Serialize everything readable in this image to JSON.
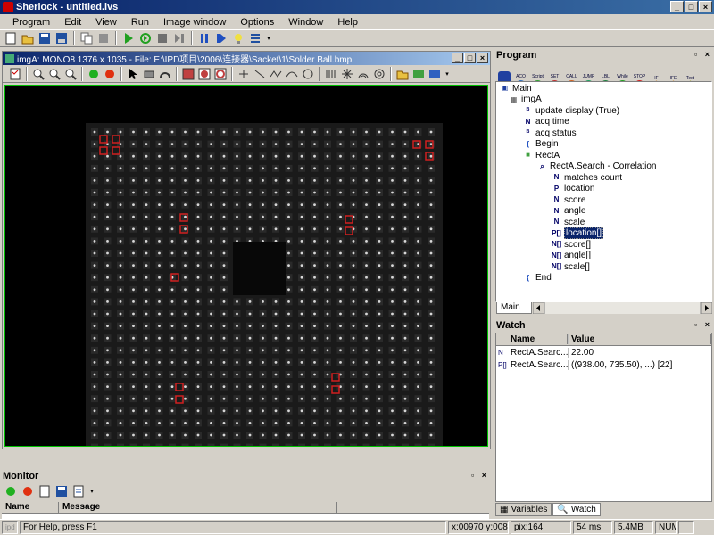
{
  "app": {
    "title": "Sherlock - untitled.ivs"
  },
  "menu": [
    "Program",
    "Edit",
    "View",
    "Run",
    "Image window",
    "Options",
    "Window",
    "Help"
  ],
  "image_window": {
    "title": "imgA: MONO8 1376 x 1035 - File: E:\\IPD项目\\2006\\连接器\\Sacket\\1\\Solder Ball.bmp"
  },
  "program": {
    "title": "Program",
    "toolbar_labels": [
      "ACQ",
      "Script",
      "SET",
      "CALL",
      "JUMP",
      "LBL",
      "While",
      "STOP",
      "IF",
      "IFE",
      "Text"
    ],
    "tree": [
      {
        "label": "Main",
        "icon": "main-icon",
        "level": 0
      },
      {
        "label": "imgA",
        "icon": "image-icon",
        "level": 1
      },
      {
        "label": "update display (True)",
        "icon": "io-icon",
        "level": 2
      },
      {
        "label": "acq time",
        "icon": "N",
        "level": 2
      },
      {
        "label": "acq status",
        "icon": "io-icon",
        "level": 2
      },
      {
        "label": "Begin",
        "icon": "brace-icon",
        "level": 2
      },
      {
        "label": "RectA",
        "icon": "rect-icon",
        "level": 2
      },
      {
        "label": "RectA.Search - Correlation",
        "icon": "search-icon",
        "level": 3
      },
      {
        "label": "matches count",
        "icon": "N",
        "level": 4
      },
      {
        "label": "location",
        "icon": "P",
        "level": 4
      },
      {
        "label": "score",
        "icon": "N",
        "level": 4
      },
      {
        "label": "angle",
        "icon": "N",
        "level": 4
      },
      {
        "label": "scale",
        "icon": "N",
        "level": 4
      },
      {
        "label": "location[]",
        "icon": "P[]",
        "level": 4
      },
      {
        "label": "score[]",
        "icon": "N[]",
        "level": 4
      },
      {
        "label": "angle[]",
        "icon": "N[]",
        "level": 4
      },
      {
        "label": "scale[]",
        "icon": "N[]",
        "level": 4
      },
      {
        "label": "End",
        "icon": "brace-icon",
        "level": 2
      }
    ],
    "tab": "Main"
  },
  "watch": {
    "title": "Watch",
    "columns": [
      "Name",
      "Value"
    ],
    "rows": [
      {
        "type": "N",
        "name": "RectA.Searc...",
        "value": "22.00"
      },
      {
        "type": "P[]",
        "name": "RectA.Searc...",
        "value": "((938.00, 735.50), ...) [22]"
      }
    ],
    "tabs": [
      "Variables",
      "Watch"
    ]
  },
  "monitor": {
    "title": "Monitor",
    "columns": [
      "Name",
      "Message"
    ]
  },
  "status": {
    "help": "For Help, press F1",
    "coords": "x:00970 y:00810",
    "pix": "pix:164",
    "time": "54 ms",
    "mem": "5.4MB",
    "num": "NUM"
  },
  "colors": {
    "title_bar": "#0a246a",
    "canvas_border": "#00c000",
    "match_marker": "#d02020"
  }
}
